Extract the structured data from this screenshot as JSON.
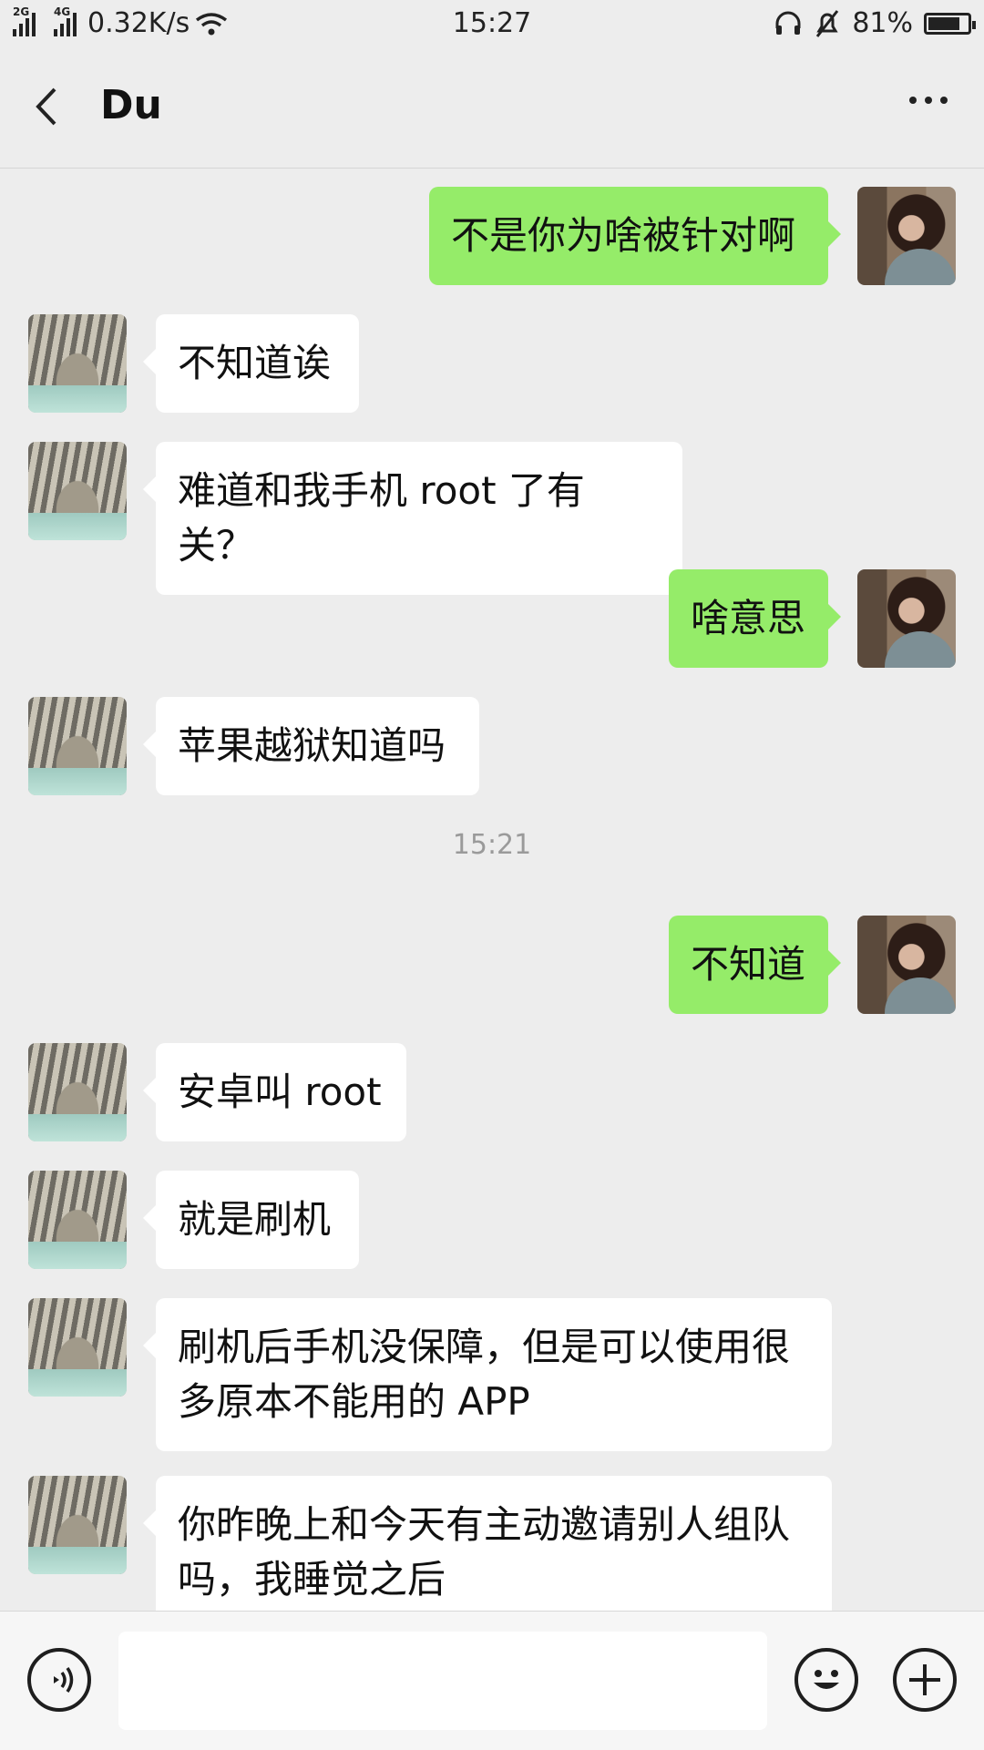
{
  "status_bar": {
    "network_2g": "2G",
    "network_4g": "4G",
    "speed": "0.32K/s",
    "time": "15:27",
    "battery_percent": "81%",
    "battery_level": 0.81,
    "icons": [
      "signal-icon",
      "wifi-icon",
      "headset-icon",
      "mute-bell-icon",
      "battery-icon"
    ]
  },
  "header": {
    "title": "Du",
    "back_icon": "chevron-left-icon",
    "more_icon": "more-dots-icon"
  },
  "messages": [
    {
      "side": "out",
      "text": "不是你为啥被针对啊"
    },
    {
      "side": "in",
      "text": "不知道诶"
    },
    {
      "side": "in",
      "text": "难道和我手机 root 了有关？"
    },
    {
      "side": "out",
      "text": "啥意思"
    },
    {
      "side": "in",
      "text": "苹果越狱知道吗"
    },
    {
      "time": "15:21"
    },
    {
      "side": "out",
      "text": "不知道"
    },
    {
      "side": "in",
      "text": "安卓叫 root"
    },
    {
      "side": "in",
      "text": "就是刷机"
    },
    {
      "side": "in",
      "text": "刷机后手机没保障，但是可以使用很多原本不能用的 APP"
    },
    {
      "side": "in",
      "text": "你昨晚上和今天有主动邀请别人组队吗，我睡觉之后"
    }
  ],
  "input_bar": {
    "text_value": "",
    "voice_icon": "voice-icon",
    "emoji_icon": "emoji-icon",
    "plus_icon": "plus-icon"
  },
  "colors": {
    "background": "#ededed",
    "outgoing_bubble": "#95ec69",
    "incoming_bubble": "#ffffff"
  }
}
